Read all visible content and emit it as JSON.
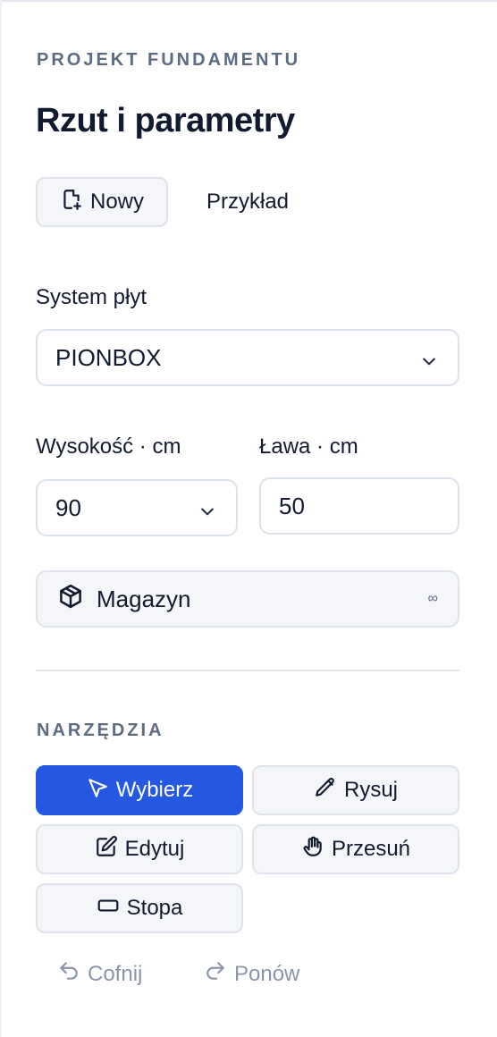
{
  "panel": {
    "eyebrow": "PROJEKT FUNDAMENTU",
    "title": "Rzut i parametry"
  },
  "actions": {
    "new_label": "Nowy",
    "new_icon": "file-plus-icon",
    "example_label": "Przykład"
  },
  "plate_system": {
    "label": "System płyt",
    "value": "PIONBOX"
  },
  "height": {
    "label": "Wysokość · cm",
    "value": "90"
  },
  "footing": {
    "label": "Ława · cm",
    "value": "50"
  },
  "warehouse": {
    "label": "Magazyn",
    "icon": "package-icon",
    "badge": "∞"
  },
  "tools": {
    "heading": "NARZĘDZIA",
    "select_label": "Wybierz",
    "draw_label": "Rysuj",
    "edit_label": "Edytuj",
    "pan_label": "Przesuń",
    "footing_label": "Stopa",
    "undo_label": "Cofnij",
    "redo_label": "Ponów"
  },
  "colors": {
    "accent": "#2558e0",
    "text": "#111a2e",
    "muted": "#8a96a8",
    "border": "#dfe4ec"
  }
}
